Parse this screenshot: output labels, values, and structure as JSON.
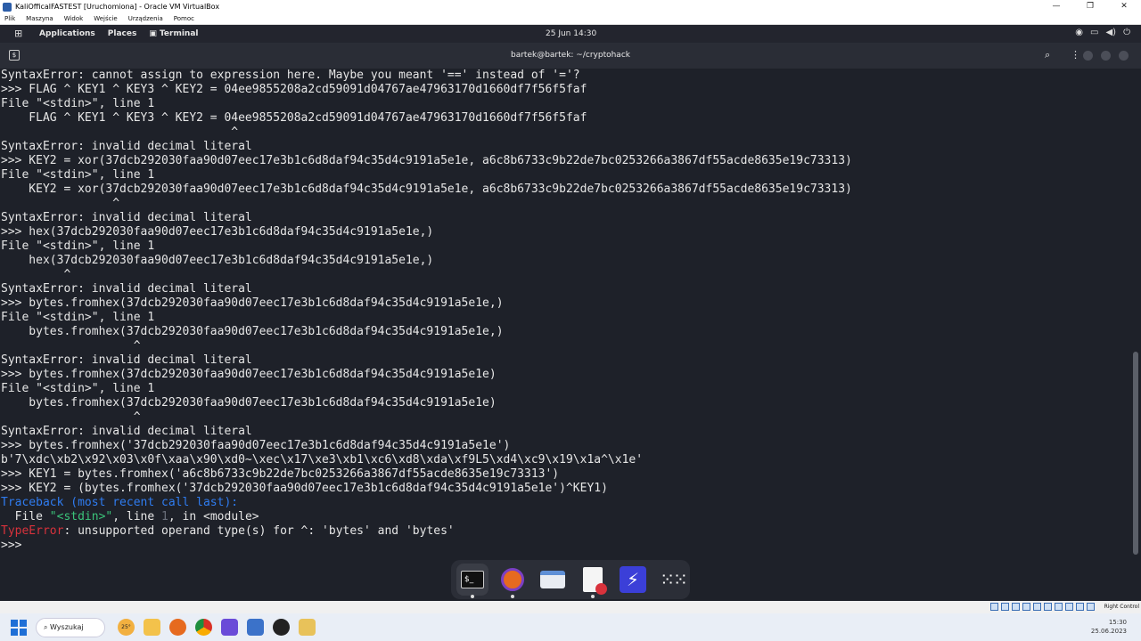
{
  "vbox": {
    "window_title": "KaliOfficalFASTEST [Uruchomiona] - Oracle VM VirtualBox",
    "menu": [
      "Plik",
      "Maszyna",
      "Widok",
      "Wejście",
      "Urządzenia",
      "Pomoc"
    ],
    "controls": [
      "—",
      "❐",
      "✕"
    ],
    "status_right": "Right Control"
  },
  "panel": {
    "applications": "Applications",
    "places": "Places",
    "terminal": "Terminal",
    "clock": "25 Jun  14:30"
  },
  "terminal_window": {
    "title": "bartek@bartek: ~/cryptohack"
  },
  "terminal": {
    "lines": [
      "SyntaxError: cannot assign to expression here. Maybe you meant '==' instead of '='?",
      ">>> FLAG ^ KEY1 ^ KEY3 ^ KEY2 = 04ee9855208a2cd59091d04767ae47963170d1660df7f56f5faf",
      "File \"<stdin>\", line 1",
      "    FLAG ^ KEY1 ^ KEY3 ^ KEY2 = 04ee9855208a2cd59091d04767ae47963170d1660df7f56f5faf",
      "                                 ^",
      "SyntaxError: invalid decimal literal",
      ">>> KEY2 = xor(37dcb292030faa90d07eec17e3b1c6d8daf94c35d4c9191a5e1e, a6c8b6733c9b22de7bc0253266a3867df55acde8635e19c73313)",
      "File \"<stdin>\", line 1",
      "    KEY2 = xor(37dcb292030faa90d07eec17e3b1c6d8daf94c35d4c9191a5e1e, a6c8b6733c9b22de7bc0253266a3867df55acde8635e19c73313)",
      "                ^",
      "SyntaxError: invalid decimal literal",
      ">>> hex(37dcb292030faa90d07eec17e3b1c6d8daf94c35d4c9191a5e1e,)",
      "File \"<stdin>\", line 1",
      "    hex(37dcb292030faa90d07eec17e3b1c6d8daf94c35d4c9191a5e1e,)",
      "         ^",
      "SyntaxError: invalid decimal literal",
      ">>> bytes.fromhex(37dcb292030faa90d07eec17e3b1c6d8daf94c35d4c9191a5e1e,)",
      "File \"<stdin>\", line 1",
      "    bytes.fromhex(37dcb292030faa90d07eec17e3b1c6d8daf94c35d4c9191a5e1e,)",
      "                   ^",
      "SyntaxError: invalid decimal literal",
      ">>> bytes.fromhex(37dcb292030faa90d07eec17e3b1c6d8daf94c35d4c9191a5e1e)",
      "File \"<stdin>\", line 1",
      "    bytes.fromhex(37dcb292030faa90d07eec17e3b1c6d8daf94c35d4c9191a5e1e)",
      "                   ^",
      "SyntaxError: invalid decimal literal",
      ">>> bytes.fromhex('37dcb292030faa90d07eec17e3b1c6d8daf94c35d4c9191a5e1e')",
      "b'7\\xdc\\xb2\\x92\\x03\\x0f\\xaa\\x90\\xd0~\\xec\\x17\\xe3\\xb1\\xc6\\xd8\\xda\\xf9L5\\xd4\\xc9\\x19\\x1a^\\x1e'",
      ">>> KEY1 = bytes.fromhex('a6c8b6733c9b22de7bc0253266a3867df55acde8635e19c73313')",
      ">>> KEY2 = (bytes.fromhex('37dcb292030faa90d07eec17e3b1c6d8daf94c35d4c9191a5e1e')^KEY1)"
    ],
    "traceback_header": "Traceback (most recent call last):",
    "traceback_file_pre": "  File ",
    "traceback_file": "\"<stdin>\"",
    "traceback_line_pre": ", line ",
    "traceback_line": "1",
    "traceback_module": ", in <module>",
    "error_type": "TypeError",
    "error_msg": ": unsupported operand type(s) for ^: 'bytes' and 'bytes'",
    "prompt": ">>>"
  },
  "dock": [
    "terminal-icon",
    "firefox-icon",
    "files-icon",
    "text-editor-icon",
    "burp-icon",
    "app-grid-icon"
  ],
  "taskbar": {
    "search_label": "Wyszukaj",
    "weather": "25°",
    "time": "15:30",
    "date": "25.06.2023"
  }
}
